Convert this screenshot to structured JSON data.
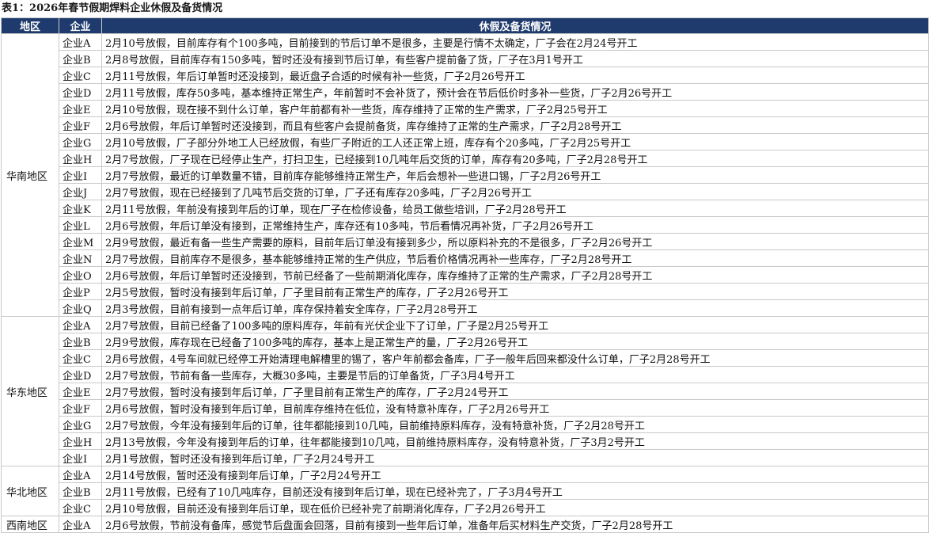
{
  "title": "表1：2026年春节假期焊料企业休假及备货情况",
  "headers": [
    "地区",
    "企业",
    "休假及备货情况"
  ],
  "regions": [
    {
      "name": "华南地区",
      "rows": [
        {
          "company": "企业A",
          "note": "2月10号放假，目前库存有个100多吨，目前接到的节后订单不是很多，主要是行情不太确定，厂子会在2月24号开工"
        },
        {
          "company": "企业B",
          "note": "2月8号放假，目前库存有150多吨，暂时还没有接到节后订单，有些客户提前备了货，厂子在3月1号开工"
        },
        {
          "company": "企业C",
          "note": "2月11号放假，年后订单暂时还没接到，最近盘子合适的时候有补一些货，厂子2月26号开工"
        },
        {
          "company": "企业D",
          "note": "2月11号放假，库存50多吨，基本维持正常生产，年前暂时不会补货了，预计会在节后低价时多补一些货，厂子2月26号开工"
        },
        {
          "company": "企业E",
          "note": "2月10号放假，现在接不到什么订单，客户年前都有补一些货，库存维持了正常的生产需求，厂子2月25号开工"
        },
        {
          "company": "企业F",
          "note": "2月6号放假，年后订单暂时还没接到，而且有些客户会提前备货，库存维持了正常的生产需求，厂子2月28号开工"
        },
        {
          "company": "企业G",
          "note": "2月10号放假，厂子部分外地工人已经放假，有些厂子附近的工人还正常上班，库存有个20多吨，厂子2月25号开工"
        },
        {
          "company": "企业H",
          "note": "2月7号放假，厂子现在已经停止生产，打扫卫生，已经接到10几吨年后交货的订单，库存有20多吨，厂子2月28号开工"
        },
        {
          "company": "企业I",
          "note": "2月7号放假，最近的订单数量不错，目前库存能够维持正常生产，年后会想补一些进口锡，厂子2月26号开工"
        },
        {
          "company": "企业J",
          "note": "2月7号放假，现在已经接到了几吨节后交货的订单，厂子还有库存20多吨，厂子2月26号开工"
        },
        {
          "company": "企业K",
          "note": "2月11号放假，年前没有接到年后的订单，现在厂子在检修设备，给员工做些培训，厂子2月28号开工"
        },
        {
          "company": "企业L",
          "note": "2月6号放假，年后订单没有接到，正常维持生产，库存还有10多吨，节后看情况再补货，厂子2月26号开工"
        },
        {
          "company": "企业M",
          "note": "2月9号放假，最近有备一些生产需要的原料，目前年后订单没有接到多少，所以原料补充的不是很多，厂子2月26号开工"
        },
        {
          "company": "企业N",
          "note": "2月7号放假，目前库存不是很多，基本能够维持正常的生产供应，节后看价格情况再补一些库存，厂子2月28号开工"
        },
        {
          "company": "企业O",
          "note": "2月6号放假，年后订单暂时还没接到，节前已经备了一些前期消化库存，库存维持了正常的生产需求，厂子2月28号开工"
        },
        {
          "company": "企业P",
          "note": "2月5号放假，暂时没有接到年后订单，厂子里目前有正常生产的库存，厂子2月26号开工"
        },
        {
          "company": "企业Q",
          "note": "2月3号放假，目前有接到一点年后订单，库存保持着安全库存，厂子2月28号开工"
        }
      ]
    },
    {
      "name": "华东地区",
      "rows": [
        {
          "company": "企业A",
          "note": "2月7号放假，目前已经备了100多吨的原料库存，年前有光伏企业下了订单，厂子是2月25号开工"
        },
        {
          "company": "企业B",
          "note": "2月9号放假，库存现在已经备了100多吨的库存，基本上是正常生产的量，厂子2月26号开工"
        },
        {
          "company": "企业C",
          "note": "2月6号放假，4号车间就已经停工开始清理电解槽里的锡了，客户年前都会备库，厂子一般年后回来都没什么订单，厂子2月28号开工"
        },
        {
          "company": "企业D",
          "note": "2月7号放假，节前有备一些库存，大概30多吨，主要是节后的订单备货，厂子3月4号开工"
        },
        {
          "company": "企业E",
          "note": "2月7号放假，暂时没有接到年后订单，厂子里目前有正常生产的库存，厂子2月24号开工"
        },
        {
          "company": "企业F",
          "note": "2月6号放假，暂时没有接到年后订单，目前库存维持在低位，没有特意补库存，厂子2月26号开工"
        },
        {
          "company": "企业G",
          "note": "2月7号放假，今年没有接到年后的订单，往年都能接到10几吨，目前维持原料库存，没有特意补货，厂子2月28号开工"
        },
        {
          "company": "企业H",
          "note": "2月13号放假，今年没有接到年后的订单，往年都能接到10几吨，目前维持原料库存，没有特意补货，厂子3月2号开工"
        },
        {
          "company": "企业I",
          "note": "2月1号放假，暂时还没有接到年后订单，厂子2月24号开工"
        }
      ]
    },
    {
      "name": "华北地区",
      "rows": [
        {
          "company": "企业A",
          "note": "2月14号放假，暂时还没有接到年后订单，厂子2月24号开工"
        },
        {
          "company": "企业B",
          "note": "2月11号放假，已经有了10几吨库存，目前还没有接到年后订单，现在已经补完了，厂子3月4号开工"
        },
        {
          "company": "企业C",
          "note": "2月10号放假，目前还没有接到年后订单，现在低价已经补完了前期消化库存，厂子2月26号开工"
        }
      ]
    },
    {
      "name": "西南地区",
      "rows": [
        {
          "company": "企业A",
          "note": "2月6号放假，节前没有备库，感觉节后盘面会回落，目前有接到一些年后订单，准备年后买材料生产交货，厂子2月28号开工"
        }
      ]
    }
  ]
}
